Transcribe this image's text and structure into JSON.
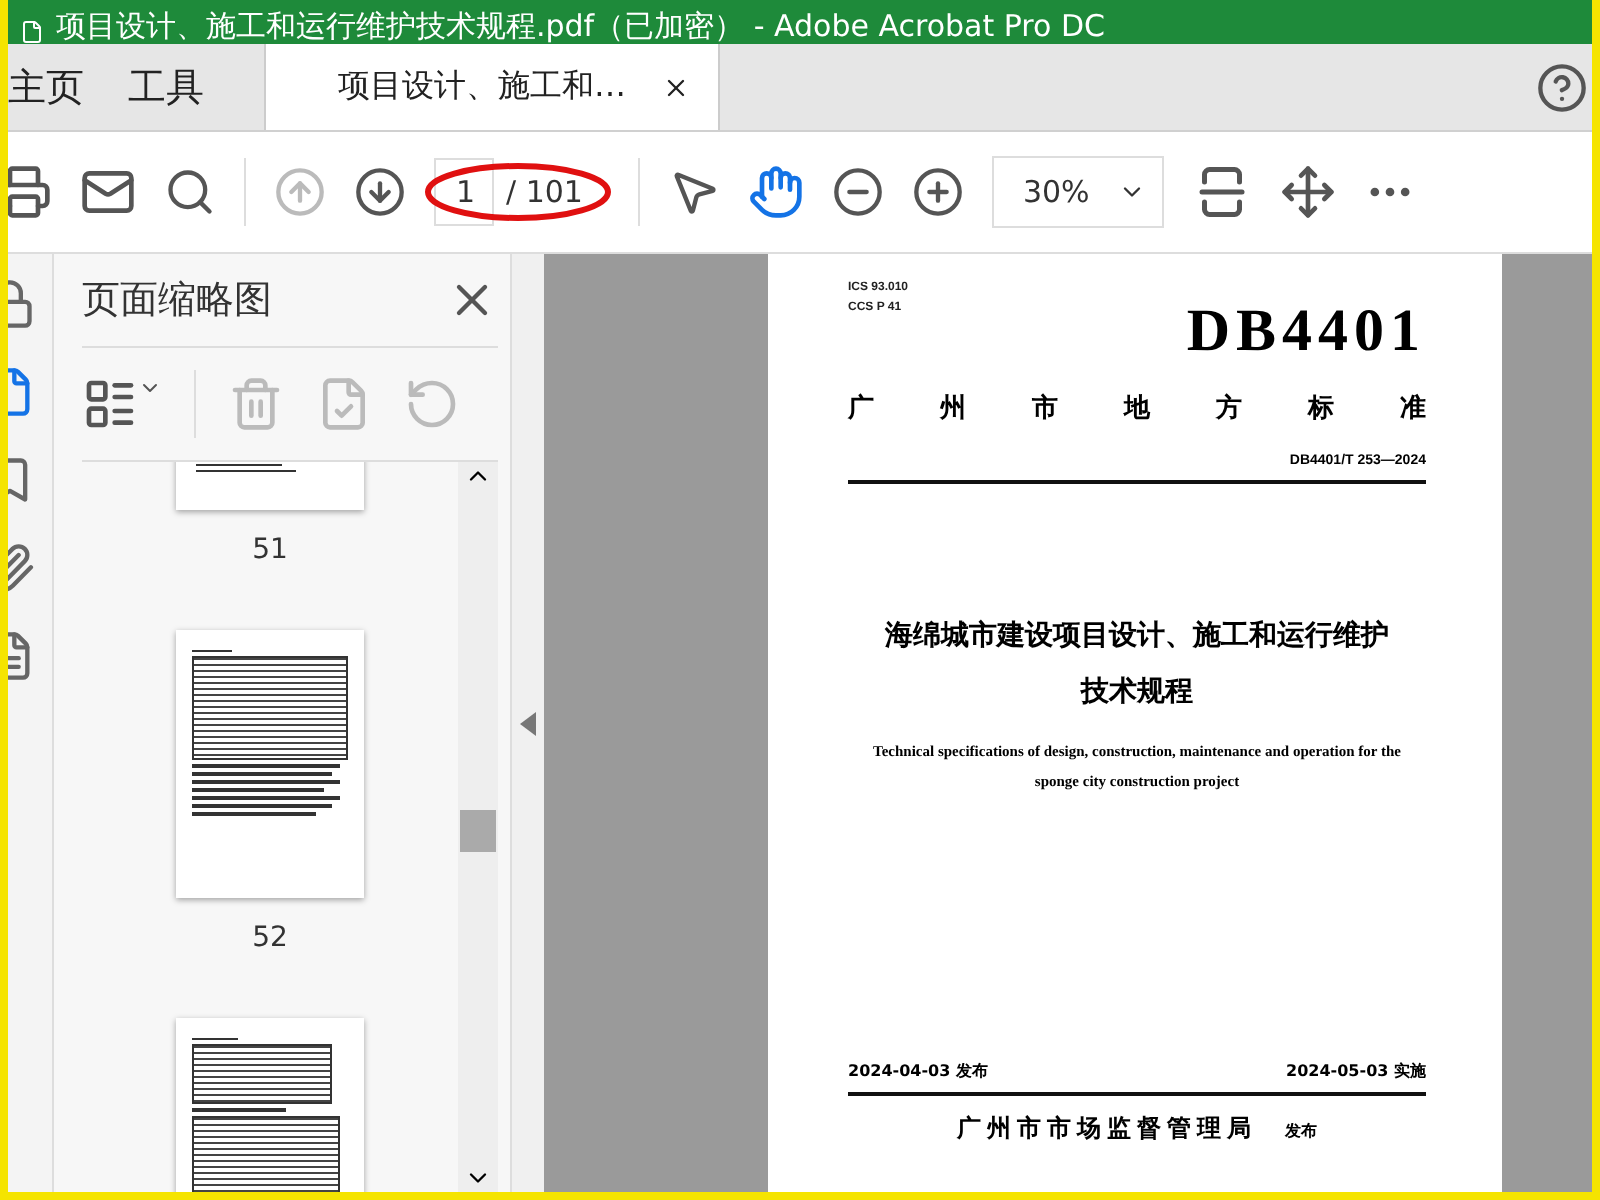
{
  "window": {
    "title": "项目设计、施工和运行维护技术规程.pdf（已加密） - Adobe Acrobat Pro DC"
  },
  "tabs": [
    {
      "label": "主页",
      "selected": false
    },
    {
      "label": "工具",
      "selected": false
    },
    {
      "label": "项目设计、施工和…",
      "selected": true,
      "closable": true
    }
  ],
  "toolbar": {
    "page_number": {
      "value": "1",
      "total": "/ 101"
    },
    "zoom": "30%",
    "prev_disabled": true,
    "select_tool_selected": false,
    "hand_tool_selected": true
  },
  "left_rail": [
    {
      "kind": "lock",
      "selected": false
    },
    {
      "kind": "pages",
      "selected": true
    },
    {
      "kind": "bookmark",
      "selected": false
    },
    {
      "kind": "attachment",
      "selected": false
    },
    {
      "kind": "document",
      "selected": false
    }
  ],
  "sidebar": {
    "title": "页面缩略图",
    "thumbnails": [
      {
        "kind": "tail",
        "label": "51"
      },
      {
        "kind": "table",
        "label": "52"
      },
      {
        "kind": "table2"
      }
    ]
  },
  "document": {
    "ics": "ICS 93.010",
    "ccs": "CCS P 41",
    "code": "DB4401",
    "category": "广 州 市 地 方 标 准",
    "number": "DB4401/T 253—2024",
    "title_lines": [
      "海绵城市建设项目设计、施工和运行维护",
      "技术规程"
    ],
    "english_title": "Technical specifications of design, construction, maintenance and operation for the sponge city construction project",
    "issue_date": "2024-04-03 发布",
    "effective_date": "2024-05-03 实施",
    "issuer": "广州市市场监督管理局",
    "issuer_suffix": "发布"
  }
}
